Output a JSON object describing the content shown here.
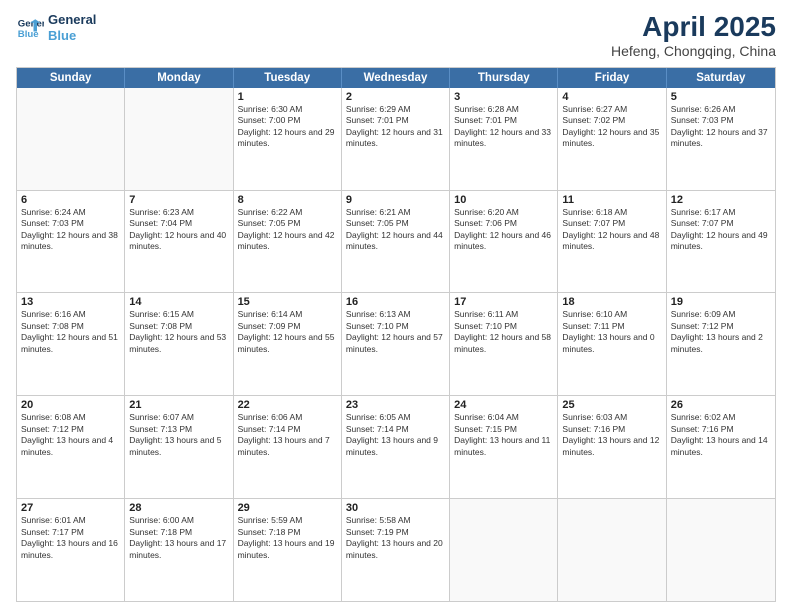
{
  "logo": {
    "line1": "General",
    "line2": "Blue",
    "icon_color": "#4a9fd4"
  },
  "title": "April 2025",
  "location": "Hefeng, Chongqing, China",
  "header_days": [
    "Sunday",
    "Monday",
    "Tuesday",
    "Wednesday",
    "Thursday",
    "Friday",
    "Saturday"
  ],
  "weeks": [
    [
      {
        "day": "",
        "sunrise": "",
        "sunset": "",
        "daylight": ""
      },
      {
        "day": "",
        "sunrise": "",
        "sunset": "",
        "daylight": ""
      },
      {
        "day": "1",
        "sunrise": "Sunrise: 6:30 AM",
        "sunset": "Sunset: 7:00 PM",
        "daylight": "Daylight: 12 hours and 29 minutes."
      },
      {
        "day": "2",
        "sunrise": "Sunrise: 6:29 AM",
        "sunset": "Sunset: 7:01 PM",
        "daylight": "Daylight: 12 hours and 31 minutes."
      },
      {
        "day": "3",
        "sunrise": "Sunrise: 6:28 AM",
        "sunset": "Sunset: 7:01 PM",
        "daylight": "Daylight: 12 hours and 33 minutes."
      },
      {
        "day": "4",
        "sunrise": "Sunrise: 6:27 AM",
        "sunset": "Sunset: 7:02 PM",
        "daylight": "Daylight: 12 hours and 35 minutes."
      },
      {
        "day": "5",
        "sunrise": "Sunrise: 6:26 AM",
        "sunset": "Sunset: 7:03 PM",
        "daylight": "Daylight: 12 hours and 37 minutes."
      }
    ],
    [
      {
        "day": "6",
        "sunrise": "Sunrise: 6:24 AM",
        "sunset": "Sunset: 7:03 PM",
        "daylight": "Daylight: 12 hours and 38 minutes."
      },
      {
        "day": "7",
        "sunrise": "Sunrise: 6:23 AM",
        "sunset": "Sunset: 7:04 PM",
        "daylight": "Daylight: 12 hours and 40 minutes."
      },
      {
        "day": "8",
        "sunrise": "Sunrise: 6:22 AM",
        "sunset": "Sunset: 7:05 PM",
        "daylight": "Daylight: 12 hours and 42 minutes."
      },
      {
        "day": "9",
        "sunrise": "Sunrise: 6:21 AM",
        "sunset": "Sunset: 7:05 PM",
        "daylight": "Daylight: 12 hours and 44 minutes."
      },
      {
        "day": "10",
        "sunrise": "Sunrise: 6:20 AM",
        "sunset": "Sunset: 7:06 PM",
        "daylight": "Daylight: 12 hours and 46 minutes."
      },
      {
        "day": "11",
        "sunrise": "Sunrise: 6:18 AM",
        "sunset": "Sunset: 7:07 PM",
        "daylight": "Daylight: 12 hours and 48 minutes."
      },
      {
        "day": "12",
        "sunrise": "Sunrise: 6:17 AM",
        "sunset": "Sunset: 7:07 PM",
        "daylight": "Daylight: 12 hours and 49 minutes."
      }
    ],
    [
      {
        "day": "13",
        "sunrise": "Sunrise: 6:16 AM",
        "sunset": "Sunset: 7:08 PM",
        "daylight": "Daylight: 12 hours and 51 minutes."
      },
      {
        "day": "14",
        "sunrise": "Sunrise: 6:15 AM",
        "sunset": "Sunset: 7:08 PM",
        "daylight": "Daylight: 12 hours and 53 minutes."
      },
      {
        "day": "15",
        "sunrise": "Sunrise: 6:14 AM",
        "sunset": "Sunset: 7:09 PM",
        "daylight": "Daylight: 12 hours and 55 minutes."
      },
      {
        "day": "16",
        "sunrise": "Sunrise: 6:13 AM",
        "sunset": "Sunset: 7:10 PM",
        "daylight": "Daylight: 12 hours and 57 minutes."
      },
      {
        "day": "17",
        "sunrise": "Sunrise: 6:11 AM",
        "sunset": "Sunset: 7:10 PM",
        "daylight": "Daylight: 12 hours and 58 minutes."
      },
      {
        "day": "18",
        "sunrise": "Sunrise: 6:10 AM",
        "sunset": "Sunset: 7:11 PM",
        "daylight": "Daylight: 13 hours and 0 minutes."
      },
      {
        "day": "19",
        "sunrise": "Sunrise: 6:09 AM",
        "sunset": "Sunset: 7:12 PM",
        "daylight": "Daylight: 13 hours and 2 minutes."
      }
    ],
    [
      {
        "day": "20",
        "sunrise": "Sunrise: 6:08 AM",
        "sunset": "Sunset: 7:12 PM",
        "daylight": "Daylight: 13 hours and 4 minutes."
      },
      {
        "day": "21",
        "sunrise": "Sunrise: 6:07 AM",
        "sunset": "Sunset: 7:13 PM",
        "daylight": "Daylight: 13 hours and 5 minutes."
      },
      {
        "day": "22",
        "sunrise": "Sunrise: 6:06 AM",
        "sunset": "Sunset: 7:14 PM",
        "daylight": "Daylight: 13 hours and 7 minutes."
      },
      {
        "day": "23",
        "sunrise": "Sunrise: 6:05 AM",
        "sunset": "Sunset: 7:14 PM",
        "daylight": "Daylight: 13 hours and 9 minutes."
      },
      {
        "day": "24",
        "sunrise": "Sunrise: 6:04 AM",
        "sunset": "Sunset: 7:15 PM",
        "daylight": "Daylight: 13 hours and 11 minutes."
      },
      {
        "day": "25",
        "sunrise": "Sunrise: 6:03 AM",
        "sunset": "Sunset: 7:16 PM",
        "daylight": "Daylight: 13 hours and 12 minutes."
      },
      {
        "day": "26",
        "sunrise": "Sunrise: 6:02 AM",
        "sunset": "Sunset: 7:16 PM",
        "daylight": "Daylight: 13 hours and 14 minutes."
      }
    ],
    [
      {
        "day": "27",
        "sunrise": "Sunrise: 6:01 AM",
        "sunset": "Sunset: 7:17 PM",
        "daylight": "Daylight: 13 hours and 16 minutes."
      },
      {
        "day": "28",
        "sunrise": "Sunrise: 6:00 AM",
        "sunset": "Sunset: 7:18 PM",
        "daylight": "Daylight: 13 hours and 17 minutes."
      },
      {
        "day": "29",
        "sunrise": "Sunrise: 5:59 AM",
        "sunset": "Sunset: 7:18 PM",
        "daylight": "Daylight: 13 hours and 19 minutes."
      },
      {
        "day": "30",
        "sunrise": "Sunrise: 5:58 AM",
        "sunset": "Sunset: 7:19 PM",
        "daylight": "Daylight: 13 hours and 20 minutes."
      },
      {
        "day": "",
        "sunrise": "",
        "sunset": "",
        "daylight": ""
      },
      {
        "day": "",
        "sunrise": "",
        "sunset": "",
        "daylight": ""
      },
      {
        "day": "",
        "sunrise": "",
        "sunset": "",
        "daylight": ""
      }
    ]
  ]
}
